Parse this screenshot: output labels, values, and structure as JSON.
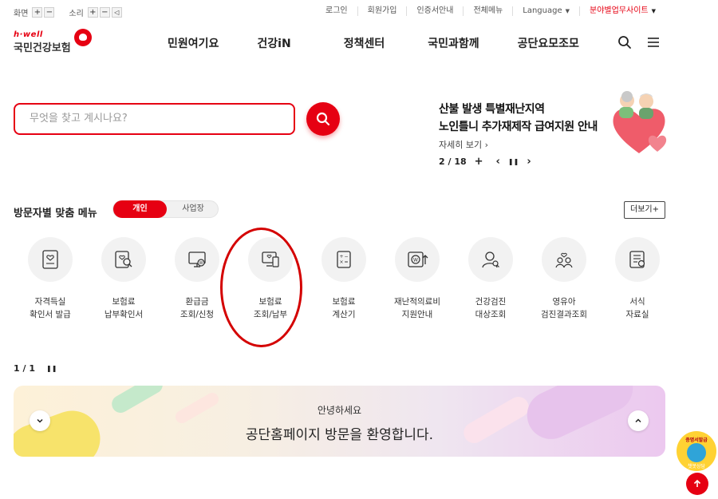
{
  "utility": {
    "screen_label": "화면",
    "sound_label": "소리",
    "plus": "+",
    "minus": "−",
    "links": [
      "로그인",
      "회원가입",
      "인증서안내",
      "전체메뉴"
    ],
    "language": "Language",
    "field_site": "분야별업무사이트"
  },
  "header": {
    "logo_top": "h·well",
    "logo_name": "국민건강보험",
    "gnb": [
      "민원여기요",
      "건강iN",
      "정책센터",
      "국민과함께",
      "공단요모조모"
    ]
  },
  "search": {
    "placeholder": "무엇을 찾고 계시나요?"
  },
  "banner": {
    "title_line1": "산불 발생 특별재난지역",
    "title_line2": "노인틀니 추가재제작 급여지원 안내",
    "more": "자세히 보기 ›",
    "counter": "2 / 18",
    "plus": "+",
    "prev": "‹",
    "pause": "❚❚",
    "next": "›"
  },
  "visitor_menu": {
    "title": "방문자별 맞춤 메뉴",
    "tab_individual": "개인",
    "tab_business": "사업장",
    "more": "더보기+",
    "items": [
      {
        "label": "자격득실\n확인서 발급",
        "icon": "id-card-heart-icon"
      },
      {
        "label": "보험료\n납부확인서",
        "icon": "document-search-icon"
      },
      {
        "label": "환급금\n조회/신청",
        "icon": "monitor-refund-icon"
      },
      {
        "label": "보험료\n조회/납부",
        "icon": "monitor-payment-icon"
      },
      {
        "label": "보험료\n계산기",
        "icon": "calculator-icon"
      },
      {
        "label": "재난적의료비\n지원안내",
        "icon": "won-support-icon"
      },
      {
        "label": "건강검진\n대상조회",
        "icon": "person-search-icon"
      },
      {
        "label": "영유아\n검진결과조회",
        "icon": "children-icon"
      },
      {
        "label": "서식\n자료실",
        "icon": "form-document-icon"
      }
    ],
    "pager": "1 / 1",
    "pause": "❚❚"
  },
  "welcome": {
    "greeting": "안녕하세요",
    "message": "공단홈페이지 방문을 환영합니다."
  },
  "floating": {
    "badge_top": "증명서발급",
    "badge_bottom": "챗봇상담"
  },
  "colors": {
    "brand_red": "#e60012",
    "circle_gray": "#f2f2f2"
  }
}
